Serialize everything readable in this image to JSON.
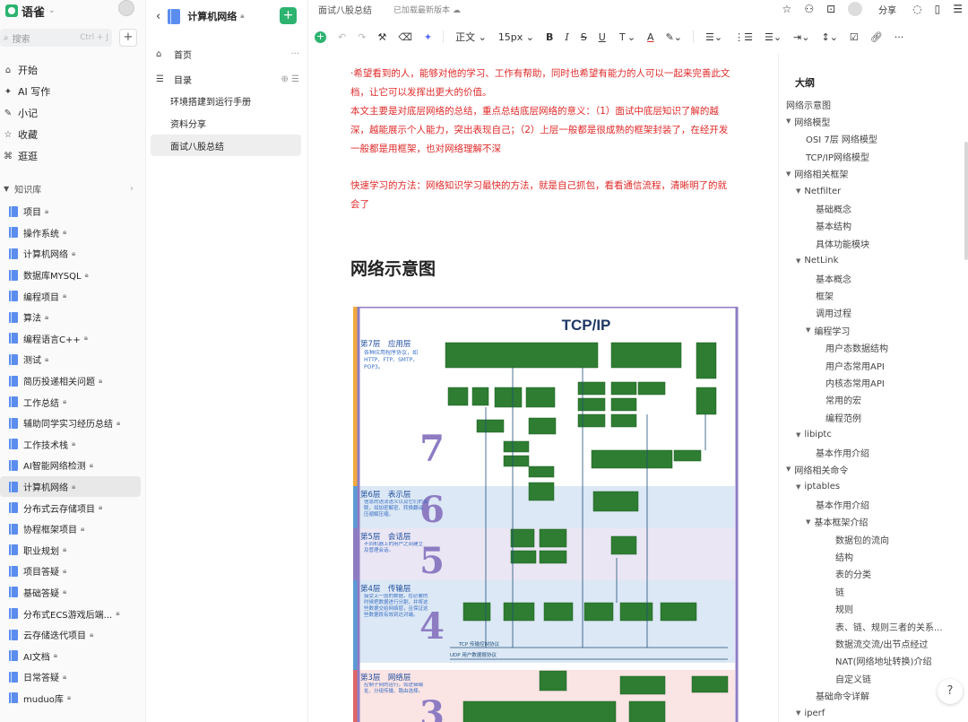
{
  "sidebar": {
    "brand": "语雀",
    "search_placeholder": "搜索",
    "search_shortcut": "Ctrl + J",
    "nav": [
      {
        "icon": "home-icon",
        "glyph": "⌂",
        "label": "开始"
      },
      {
        "icon": "ai-icon",
        "glyph": "✦",
        "label": "AI 写作"
      },
      {
        "icon": "note-icon",
        "glyph": "✎",
        "label": "小记"
      },
      {
        "icon": "star-icon",
        "glyph": "☆",
        "label": "收藏"
      },
      {
        "icon": "discover-icon",
        "glyph": "⌘",
        "label": "逛逛"
      }
    ],
    "kb_header": "知识库",
    "kb_items": [
      {
        "label": "项目",
        "lock": true
      },
      {
        "label": "操作系统",
        "lock": true
      },
      {
        "label": "计算机网络",
        "lock": true
      },
      {
        "label": "数据库MYSQL",
        "lock": true
      },
      {
        "label": "编程项目",
        "lock": true
      },
      {
        "label": "算法",
        "lock": true
      },
      {
        "label": "编程语言C++",
        "lock": true
      },
      {
        "label": "测试",
        "lock": true
      },
      {
        "label": "简历投递相关问题",
        "lock": true
      },
      {
        "label": "工作总结",
        "lock": true
      },
      {
        "label": "辅助同学实习经历总结",
        "lock": true
      },
      {
        "label": "工作技术栈",
        "lock": true
      },
      {
        "label": "AI智能网络检测",
        "lock": true
      },
      {
        "label": "计算机网络",
        "lock": true
      },
      {
        "label": "分布式云存储项目",
        "lock": true
      },
      {
        "label": "协程框架项目",
        "lock": true
      },
      {
        "label": "职业规划",
        "lock": true
      },
      {
        "label": "项目答疑",
        "lock": true
      },
      {
        "label": "基础答疑",
        "lock": true
      },
      {
        "label": "分布式ECS游戏后端...",
        "lock": true
      },
      {
        "label": "云存储迭代项目",
        "lock": true
      },
      {
        "label": "AI文档",
        "lock": true
      },
      {
        "label": "日常答疑",
        "lock": true
      },
      {
        "label": "muduo库",
        "lock": true
      }
    ]
  },
  "panel": {
    "title": "计算机网络",
    "home": "首页",
    "toc": "目录",
    "docs": [
      "环境搭建到运行手册",
      "资料分享",
      "面试八股总结"
    ]
  },
  "topbar": {
    "crumb": "面试八股总结",
    "saved": "已加载最新版本",
    "share": "分享"
  },
  "toolbar": {
    "style": "正文",
    "size": "15px"
  },
  "doc": {
    "p1": "·希望看到的人，能够对他的学习、工作有帮助，同时也希望有能力的人可以一起来完善此文档，让它可以发挥出更大的价值。",
    "p2": "本文主要是对底层网络的总结，重点总结底层网络的意义：（1）面试中底层知识了解的越深，越能展示个人能力，突出表现自己；（2）上层一般都是很成熟的框架封装了，在经开发一般都是用框架，也对网络理解不深",
    "p3": "快速学习的方法：网络知识学习最快的方法，就是自己抓包，看看通信流程，清晰明了的就会了",
    "h1": "网络示意图"
  },
  "diagram": {
    "title": "TCP/IP",
    "layers": [
      {
        "num": "7",
        "name": "第7层　应用层",
        "desc": "各种应用程序协议，如HTTP、FTP、SMTP、POP3。"
      },
      {
        "num": "6",
        "name": "第6层　表示层",
        "desc": "信息的语法语义以及它们的关联，如加密解密、转换翻译、压缩解压缩。"
      },
      {
        "num": "5",
        "name": "第5层　会话层",
        "desc": "不同机器上的用户之间建立及管理会话。"
      },
      {
        "num": "4",
        "name": "第4层　传输层",
        "desc": "接受上一层的数据，在必要的时候把数据进行分割，并将这些数据交给网络层，且保证这些数据段有效到达对端。"
      },
      {
        "num": "3",
        "name": "第3层　网络层",
        "desc": "控制子网的运行，如逻辑编址、分组传输、路由选择。"
      }
    ],
    "tcp_label": "TCP 传输控制协议",
    "udp_label": "UDP 用户数据报协议"
  },
  "outline": {
    "title": "大纲",
    "items": [
      {
        "level": 0,
        "arrow": false,
        "label": "网络示意图"
      },
      {
        "level": 0,
        "arrow": true,
        "label": "网络模型"
      },
      {
        "level": 2,
        "arrow": false,
        "label": "OSI 7层 网络模型"
      },
      {
        "level": 2,
        "arrow": false,
        "label": "TCP/IP网络模型"
      },
      {
        "level": 0,
        "arrow": true,
        "label": "网络相关框架"
      },
      {
        "level": 1,
        "arrow": true,
        "label": "Netfilter"
      },
      {
        "level": 3,
        "arrow": false,
        "label": "基础概念"
      },
      {
        "level": 3,
        "arrow": false,
        "label": "基本结构"
      },
      {
        "level": 3,
        "arrow": false,
        "label": "具体功能模块"
      },
      {
        "level": 1,
        "arrow": true,
        "label": "NetLink"
      },
      {
        "level": 3,
        "arrow": false,
        "label": "基本概念"
      },
      {
        "level": 3,
        "arrow": false,
        "label": "框架"
      },
      {
        "level": 3,
        "arrow": false,
        "label": "调用过程"
      },
      {
        "level": 2,
        "arrow": true,
        "label": "编程学习"
      },
      {
        "level": 4,
        "arrow": false,
        "label": "用户态数据结构"
      },
      {
        "level": 4,
        "arrow": false,
        "label": "用户态常用API"
      },
      {
        "level": 4,
        "arrow": false,
        "label": "内核态常用API"
      },
      {
        "level": 4,
        "arrow": false,
        "label": "常用的宏"
      },
      {
        "level": 4,
        "arrow": false,
        "label": "编程范例"
      },
      {
        "level": 1,
        "arrow": true,
        "label": "libiptc"
      },
      {
        "level": 3,
        "arrow": false,
        "label": "基本作用介绍"
      },
      {
        "level": 0,
        "arrow": true,
        "label": "网络相关命令"
      },
      {
        "level": 1,
        "arrow": true,
        "label": "iptables"
      },
      {
        "level": 3,
        "arrow": false,
        "label": "基本作用介绍"
      },
      {
        "level": 2,
        "arrow": true,
        "label": "基本框架介绍"
      },
      {
        "level": 5,
        "arrow": false,
        "label": "数据包的流向"
      },
      {
        "level": 5,
        "arrow": false,
        "label": "结构"
      },
      {
        "level": 5,
        "arrow": false,
        "label": "表的分类"
      },
      {
        "level": 5,
        "arrow": false,
        "label": "链"
      },
      {
        "level": 5,
        "arrow": false,
        "label": "规则"
      },
      {
        "level": 5,
        "arrow": false,
        "label": "表、链、规则三者的关系..."
      },
      {
        "level": 5,
        "arrow": false,
        "label": "数据流交流/出节点经过"
      },
      {
        "level": 5,
        "arrow": false,
        "label": "NAT(网络地址转换)介绍"
      },
      {
        "level": 5,
        "arrow": false,
        "label": "自定义链"
      },
      {
        "level": 3,
        "arrow": false,
        "label": "基础命令详解"
      },
      {
        "level": 1,
        "arrow": true,
        "label": "iperf"
      }
    ]
  }
}
